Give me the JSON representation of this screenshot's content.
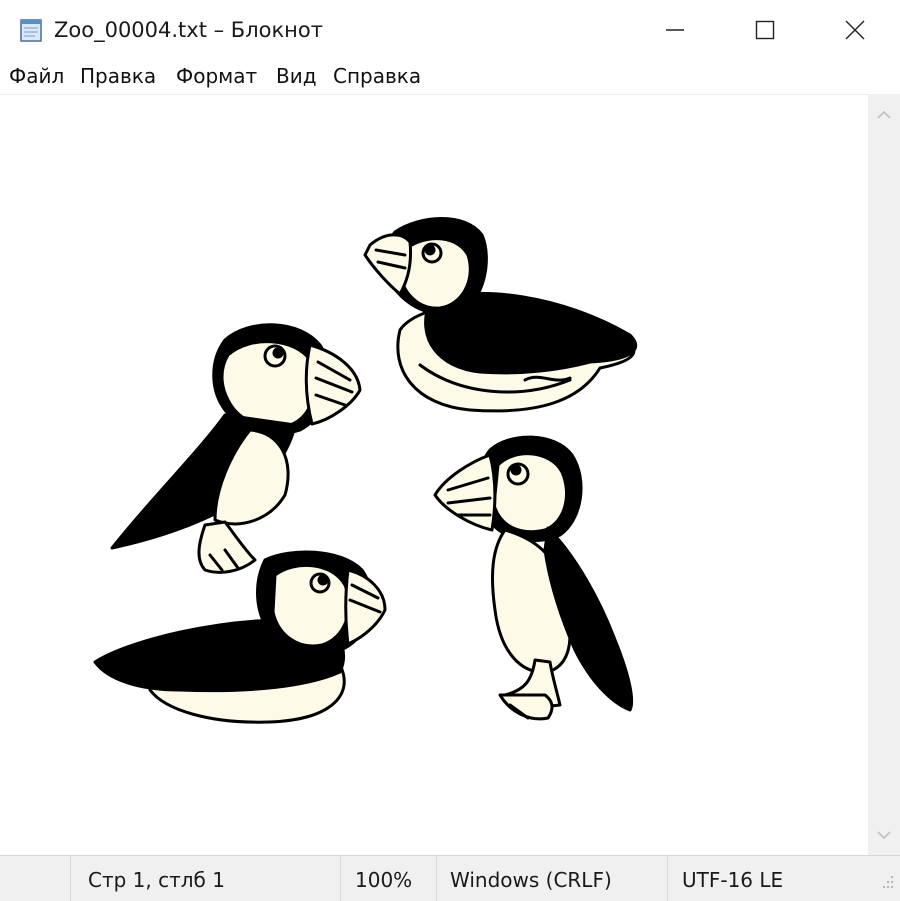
{
  "window": {
    "title": "Zoo_00004.txt – Блокнот"
  },
  "menu": {
    "items": [
      "Файл",
      "Правка",
      "Формат",
      "Вид",
      "Справка"
    ]
  },
  "editor": {
    "content": "four puffins ascii-art drawing"
  },
  "statusbar": {
    "position": "Стр 1, стлб 1",
    "zoom": "100%",
    "line_ending": "Windows (CRLF)",
    "encoding": "UTF-16 LE"
  },
  "icons": {
    "app": "notepad-icon",
    "minimize": "minimize-icon",
    "maximize": "maximize-icon",
    "close": "close-icon",
    "scroll_up": "chevron-up-icon",
    "scroll_down": "chevron-down-icon",
    "grip": "resize-grip-icon"
  },
  "colors": {
    "ink": "#000000",
    "paper": "#fdfbe8",
    "chrome": "#f0f0f0"
  }
}
